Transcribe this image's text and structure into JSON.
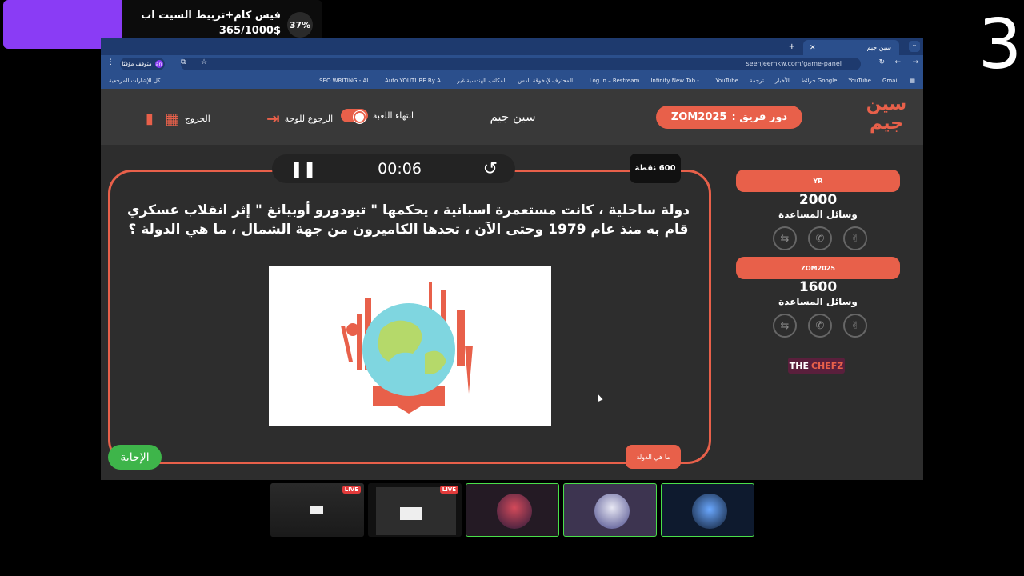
{
  "goal": {
    "title": "فيس كام+تزبيط السيت اب",
    "amount": "365/1000$",
    "percent": "37%",
    "progress": 0.37
  },
  "big_number": "3",
  "browser": {
    "tab_title": "سين جيم",
    "url": "seenjeemkw.com/game-panel",
    "profile_label": "متوقف مؤقتًا",
    "profile_initial": "an",
    "bookmarks": [
      "Gmail",
      "YouTube",
      "خرائط Google",
      "الأخبار",
      "ترجمة",
      "YouTube",
      "Infinity New Tab -...",
      "Log In – Restream",
      "المحترف لإدخوقة الدس...",
      "المكاتب الهندسية غير",
      "Auto YOUTUBE By A...",
      "SEO WRITING - AI..."
    ],
    "all_bookmarks": "كل الإشارات المرجعية"
  },
  "header": {
    "logo_text": "سين جيم",
    "turn_label": "دور فريق :",
    "turn_team": "ZOM2025",
    "game_name": "سين جيم",
    "end_game": "انتهاء اللعبة",
    "back_to_board": "الرجوع للوحة",
    "exit": "الخروج"
  },
  "question": {
    "points": "600 نقطة",
    "timer": "00:06",
    "text": "دولة ساحلية ، كانت مستعمرة اسبانية ، يحكمها \" تيودورو أوبيانغ \" إثر انقلاب عسكري قام به منذ عام 1979 وحتى الآن ، تحدها الكاميرون من جهة الشمال ، ما هي الدولة ؟",
    "answer_button": "الإجابة",
    "category_button": "ما هي الدولة"
  },
  "teams": [
    {
      "name": "YR",
      "score": "2000",
      "helpers_label": "وسائل المساعدة"
    },
    {
      "name": "ZOM2025",
      "score": "1600",
      "helpers_label": "وسائل المساعدة"
    }
  ],
  "sponsor": {
    "part1": "THE",
    "part2": "CHEFZ"
  },
  "thumbnails": [
    {
      "live": "LIVE"
    },
    {
      "live": "LIVE"
    }
  ],
  "colors": {
    "accent": "#e8604a",
    "answer_green": "#3eb54a",
    "goal_purple": "#8a3cf5",
    "panel": "#2d2d2d"
  }
}
